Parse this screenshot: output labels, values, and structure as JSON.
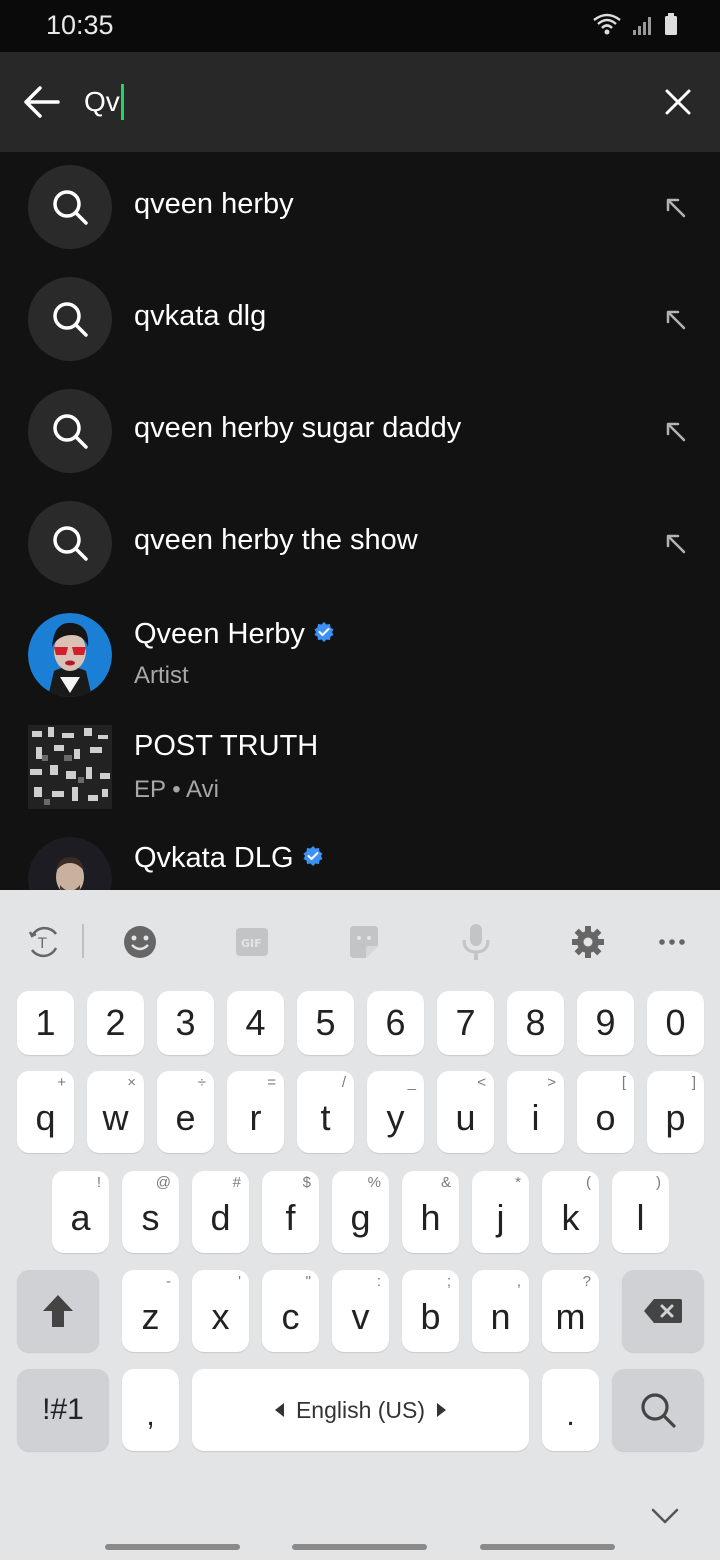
{
  "status_bar": {
    "time": "10:35"
  },
  "search": {
    "query": "Qv"
  },
  "suggestions": [
    {
      "text": "qveen herby"
    },
    {
      "text": "qvkata dlg"
    },
    {
      "text": "qveen herby sugar daddy"
    },
    {
      "text": "qveen herby the show"
    }
  ],
  "results": [
    {
      "title": "Qveen Herby",
      "subtitle": "Artist",
      "verified": true
    },
    {
      "title": "POST TRUTH",
      "subtitle": "EP • Avi",
      "verified": false
    },
    {
      "title": "Qvkata DLG",
      "subtitle": "",
      "verified": true
    }
  ],
  "keyboard": {
    "toolbar_icons": [
      "text-recognition-icon",
      "emoji-icon",
      "gif-icon",
      "sticker-icon",
      "microphone-icon",
      "settings-icon",
      "more-icon"
    ],
    "gif_label": "GIF",
    "number_row": [
      "1",
      "2",
      "3",
      "4",
      "5",
      "6",
      "7",
      "8",
      "9",
      "0"
    ],
    "row1": [
      {
        "key": "q",
        "hint": "+"
      },
      {
        "key": "w",
        "hint": "×"
      },
      {
        "key": "e",
        "hint": "÷"
      },
      {
        "key": "r",
        "hint": "="
      },
      {
        "key": "t",
        "hint": "/"
      },
      {
        "key": "y",
        "hint": "_"
      },
      {
        "key": "u",
        "hint": "<"
      },
      {
        "key": "i",
        "hint": ">"
      },
      {
        "key": "o",
        "hint": "["
      },
      {
        "key": "p",
        "hint": "]"
      }
    ],
    "row2": [
      {
        "key": "a",
        "hint": "!"
      },
      {
        "key": "s",
        "hint": "@"
      },
      {
        "key": "d",
        "hint": "#"
      },
      {
        "key": "f",
        "hint": "$"
      },
      {
        "key": "g",
        "hint": "%"
      },
      {
        "key": "h",
        "hint": "&"
      },
      {
        "key": "j",
        "hint": "*"
      },
      {
        "key": "k",
        "hint": "("
      },
      {
        "key": "l",
        "hint": ")"
      }
    ],
    "row3": [
      {
        "key": "z",
        "hint": "-"
      },
      {
        "key": "x",
        "hint": "'"
      },
      {
        "key": "c",
        "hint": "\""
      },
      {
        "key": "v",
        "hint": ":"
      },
      {
        "key": "b",
        "hint": ";"
      },
      {
        "key": "n",
        "hint": ","
      },
      {
        "key": "m",
        "hint": "?"
      }
    ],
    "symbols_label": "!#1",
    "comma_label": ",",
    "space_label": "English (US)",
    "period_label": "."
  },
  "colors": {
    "accent": "#1ed760",
    "verified_blue": "#3d91f4",
    "background": "#121212"
  }
}
